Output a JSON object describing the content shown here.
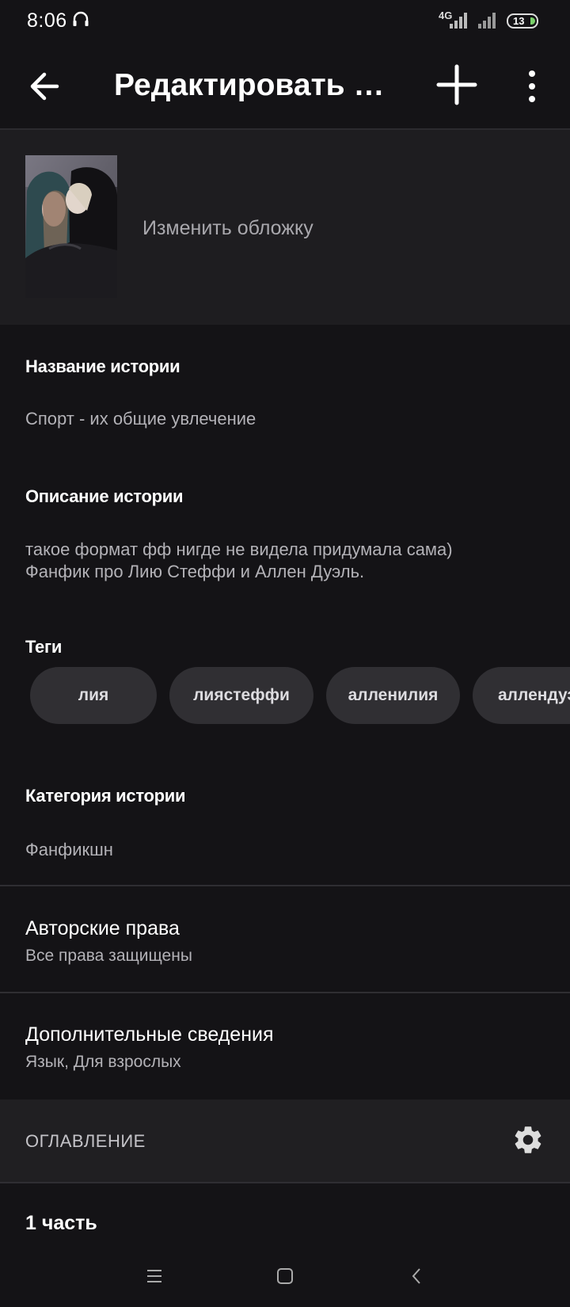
{
  "status_bar": {
    "time": "8:06",
    "network": "4G",
    "battery": "13",
    "headphone_icon": "headphones-icon"
  },
  "toolbar": {
    "title": "Редактировать и...",
    "back_icon": "arrow-left-icon",
    "add_icon": "plus-icon",
    "more_icon": "more-vertical-icon"
  },
  "cover": {
    "change_label": "Изменить обложку"
  },
  "story": {
    "title_label": "Название истории",
    "title_value": "Спорт - их общие увлечение",
    "description_label": "Описание истории",
    "description_lines": [
      "такое формат фф нигде не видела придумала сама)",
      "Фанфик про Лию Стеффи и Аллен Дуэль."
    ],
    "tags_label": "Теги",
    "tags": [
      "лия",
      "лиястеффи",
      "алленилия",
      "аллендуэ"
    ],
    "category_label": "Категория истории",
    "category_value": "Фанфикшн"
  },
  "copyright": {
    "title": "Авторские права",
    "value": "Все права защищены"
  },
  "additional": {
    "title": "Дополнительные сведения",
    "value": "Язык, Для взрослых"
  },
  "toc": {
    "title": "ОГЛАВЛЕНИЕ",
    "settings_icon": "gear-icon"
  },
  "parts": [
    {
      "title": "1 часть"
    }
  ],
  "nav_bar": {
    "menu_icon": "menu-icon",
    "home_icon": "square-home-icon",
    "back_icon": "chevron-left-icon"
  },
  "colors": {
    "background": "#141316",
    "section_bg": "#1e1d20",
    "tag_bg": "#302f33",
    "secondary_text": "#b3b2b7"
  }
}
